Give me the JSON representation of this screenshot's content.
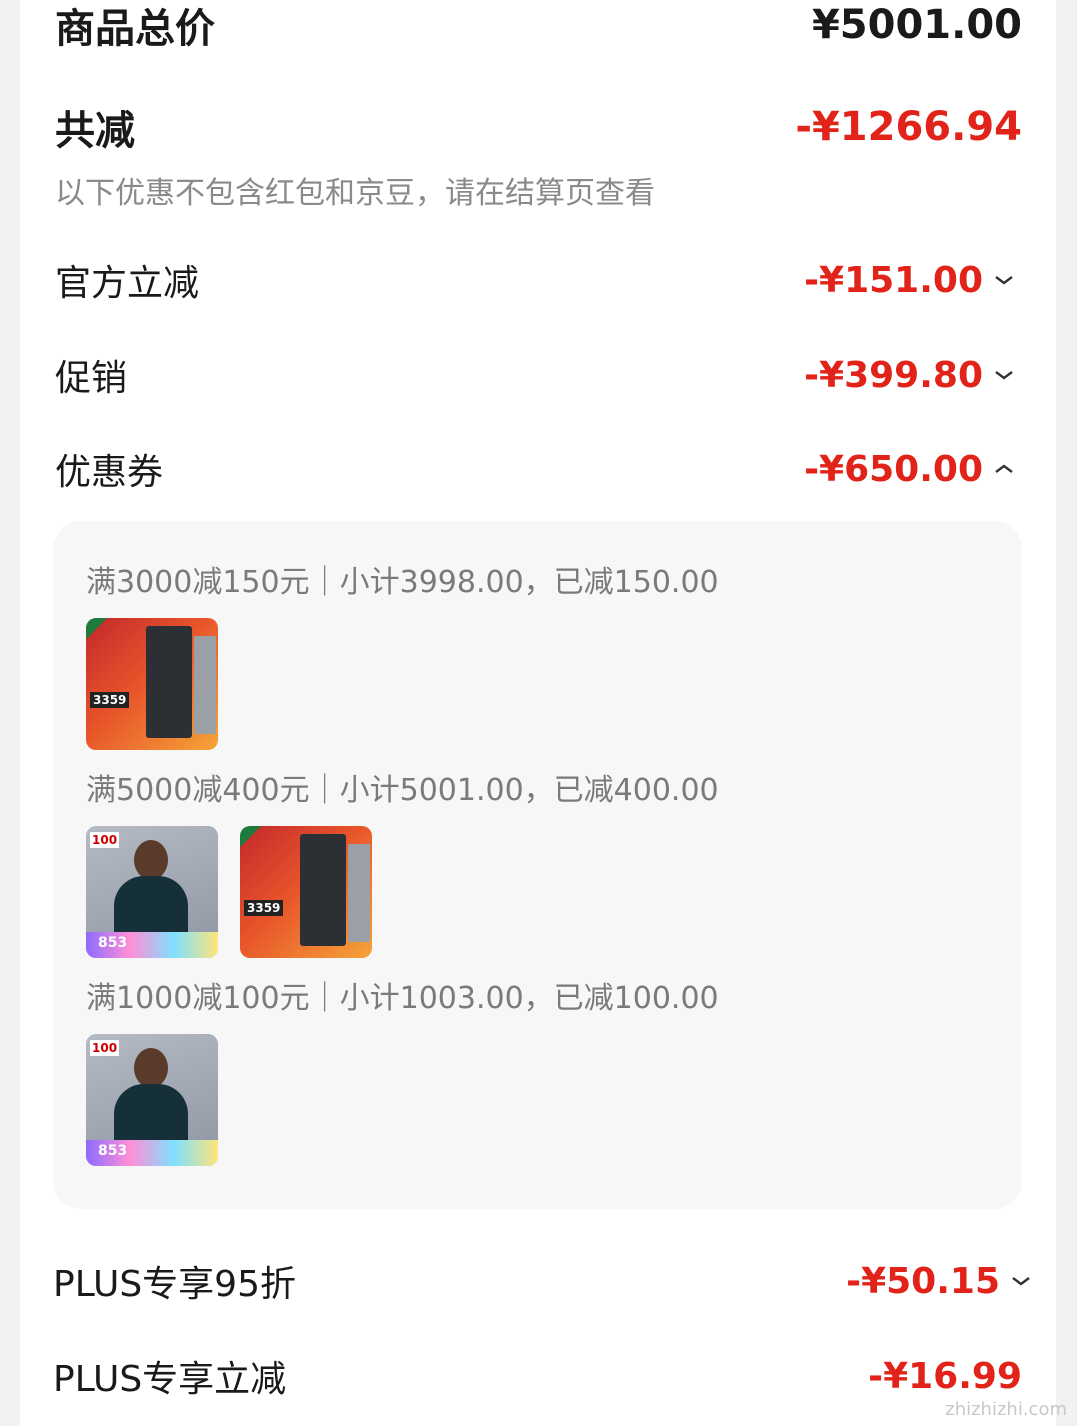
{
  "summary": {
    "total_label": "商品总价",
    "total_value": "¥5001.00",
    "reduce_label": "共减",
    "reduce_value": "-¥1266.94",
    "note": "以下优惠不包含红包和京豆，请在结算页查看"
  },
  "discounts": [
    {
      "label": "官方立减",
      "value": "-¥151.00",
      "expanded": false
    },
    {
      "label": "促销",
      "value": "-¥399.80",
      "expanded": false
    },
    {
      "label": "优惠券",
      "value": "-¥650.00",
      "expanded": true
    },
    {
      "label": "PLUS专享95折",
      "value": "-¥50.15",
      "expanded": false
    },
    {
      "label": "PLUS专享立减",
      "value": "-¥16.99",
      "expanded": false
    }
  ],
  "coupons": [
    {
      "text": "满3000减150元｜小计3998.00，已减150.00",
      "items": [
        "fridge"
      ]
    },
    {
      "text": "满5000减400元｜小计5001.00，已减400.00",
      "items": [
        "jacket",
        "fridge"
      ]
    },
    {
      "text": "满1000减100元｜小计1003.00，已减100.00",
      "items": [
        "jacket"
      ]
    }
  ],
  "thumb_text": {
    "fridge_price": "3359",
    "jacket_badge": "100",
    "jacket_price": "853"
  },
  "icons": {
    "chevron_down": "chevron-down-icon",
    "chevron_up": "chevron-up-icon"
  },
  "colors": {
    "accent": "#e2231a",
    "text": "#1a1a1a",
    "muted": "#8a8a8a"
  },
  "watermark": "zhizhizhi.com"
}
